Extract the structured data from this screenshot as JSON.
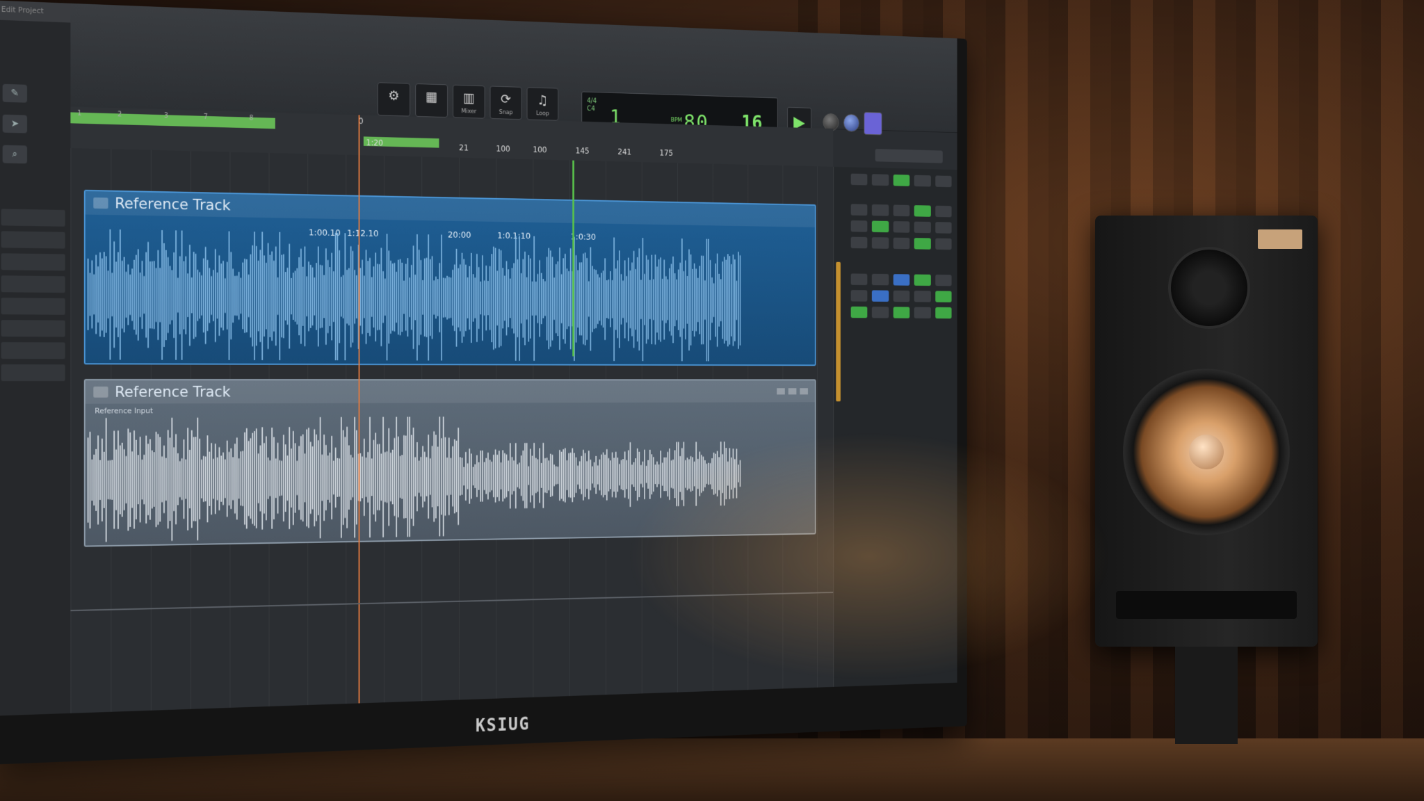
{
  "window": {
    "menu_label": "Edit  Project"
  },
  "toolbar": {
    "buttons": [
      {
        "icon": "gear-icon",
        "glyph": "⚙",
        "label": ""
      },
      {
        "icon": "grid-icon",
        "glyph": "▦",
        "label": ""
      },
      {
        "icon": "mixer-icon",
        "glyph": "▥",
        "label": "Mixer"
      },
      {
        "icon": "loop-icon",
        "glyph": "⟳",
        "label": "Snap"
      },
      {
        "icon": "instrument-icon",
        "glyph": "♫",
        "label": "Loop"
      }
    ]
  },
  "transport": {
    "bar": "1",
    "tempo": "80",
    "beat": "16",
    "play_glyph": "▶"
  },
  "ruler": {
    "top_ticks": [
      "1",
      "2",
      "3",
      "7",
      "8"
    ],
    "ticks": [
      "0",
      "1:20",
      "21",
      "100",
      "100",
      "145",
      "241",
      "175"
    ]
  },
  "tracks": [
    {
      "name": "Reference Track",
      "markers": [
        "1:00.10",
        "1:12.10",
        "20:00",
        "1:0.1:10",
        "1:0:30"
      ],
      "sub_label": ""
    },
    {
      "name": "Reference Track",
      "markers": [],
      "sub_label": "Reference Input"
    }
  ],
  "colors": {
    "accent_green": "#7ee36a",
    "track1": "#1f5f95",
    "track2": "#5e6c7a",
    "playhead": "#e27a3f"
  },
  "monitor": {
    "brand": "KSIUG"
  }
}
